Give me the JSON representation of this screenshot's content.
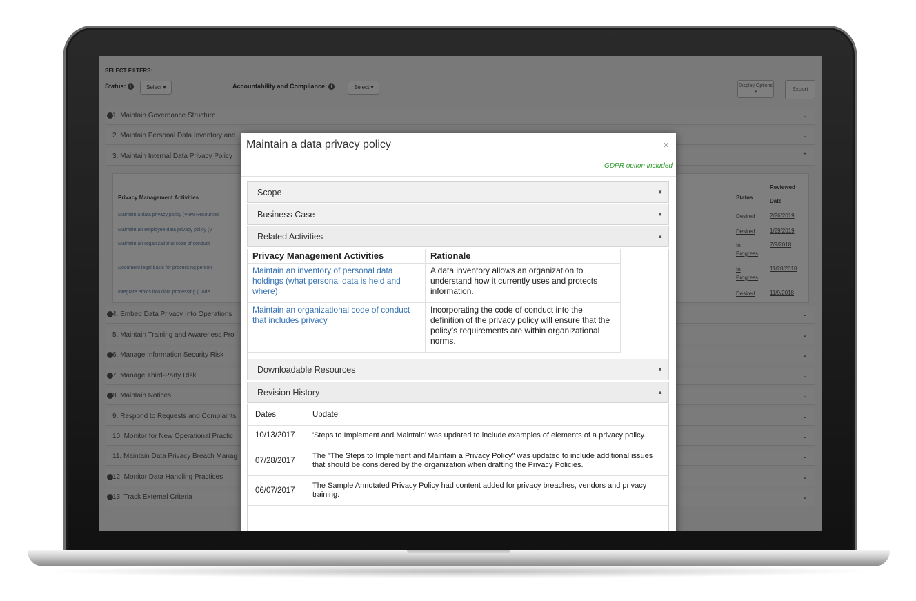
{
  "background_app": {
    "select_filters_label": "SELECT FILTERS:",
    "status_label": "Status:",
    "status_select": "Select ▾",
    "accountability_label": "Accountability and Compliance:",
    "accountability_select": "Select ▾",
    "display_options": "Display Options ▾",
    "export": "Export",
    "sections": [
      {
        "label": "1. Maintain Governance Structure"
      },
      {
        "label": "2. Maintain Personal Data Inventory and"
      },
      {
        "label": "3. Maintain Internal Data Privacy Policy"
      },
      {
        "label": "4. Embed Data Privacy Into Operations"
      },
      {
        "label": "5. Maintain Training and Awareness Pro"
      },
      {
        "label": "6. Manage Information Security Risk"
      },
      {
        "label": "7. Manage Third-Party Risk"
      },
      {
        "label": "8. Maintain Notices"
      },
      {
        "label": "9. Respond to Requests and Complaints"
      },
      {
        "label": "10. Monitor for New Operational Practic"
      },
      {
        "label": "11. Maintain Data Privacy Breach Manag"
      },
      {
        "label": "12. Monitor Data Handling Practices"
      },
      {
        "label": "13. Track External Criteria"
      }
    ],
    "inner_table": {
      "col_activities": "Privacy Management Activities",
      "col_status": "Status",
      "col_reviewed": "Reviewed Date",
      "rows": [
        {
          "activity": "Maintain a data privacy policy (View Resources",
          "status": "Desired",
          "date": "2/26/2019"
        },
        {
          "activity": "Maintain an employee data privacy policy (V",
          "status": "Desired",
          "date": "1/29/2019"
        },
        {
          "activity": "Maintain an organizational code of conduct",
          "status": "In Progress",
          "date": "7/9/2018"
        },
        {
          "activity": "Document legal basis for processing person",
          "status": "In Progress",
          "date": "11/28/2018"
        },
        {
          "activity": "Integrate ethics into data processing (Code",
          "status": "Desired",
          "date": "11/9/2018"
        }
      ]
    }
  },
  "modal": {
    "title": "Maintain a data privacy policy",
    "close_symbol": "×",
    "gdpr_note": "GDPR option included",
    "panels": {
      "scope": {
        "label": "Scope",
        "caret": "▼"
      },
      "business_case": {
        "label": "Business Case",
        "caret": "▼"
      },
      "related_activities": {
        "label": "Related Activities",
        "caret": "▲"
      },
      "downloadable_resources": {
        "label": "Downloadable Resources",
        "caret": "▼"
      },
      "revision_history": {
        "label": "Revision History",
        "caret": "▲"
      }
    },
    "related_table": {
      "col_activities": "Privacy Management Activities",
      "col_rationale": "Rationale",
      "rows": [
        {
          "activity": "Maintain an inventory of personal data holdings (what personal data is held and where)",
          "rationale": "A data inventory allows an organization to understand how it currently uses and protects information."
        },
        {
          "activity": "Maintain an organizational code of conduct that includes privacy",
          "rationale": "Incorporating the code of conduct into the definition of the privacy policy will ensure that the policy’s requirements are within organizational norms."
        }
      ]
    },
    "revision_table": {
      "col_dates": "Dates",
      "col_update": "Update",
      "rows": [
        {
          "date": "10/13/2017",
          "update": "'Steps to Implement and Maintain' was updated to include examples of elements of a privacy policy."
        },
        {
          "date": "07/28/2017",
          "update": "The \"The Steps to Implement and Maintain a Privacy Policy\" was updated to include additional issues that should be considered by the organization when drafting the Privacy Policies."
        },
        {
          "date": "06/07/2017",
          "update": "The Sample Annotated Privacy Policy had content added for privacy breaches, vendors and privacy training."
        }
      ]
    }
  }
}
